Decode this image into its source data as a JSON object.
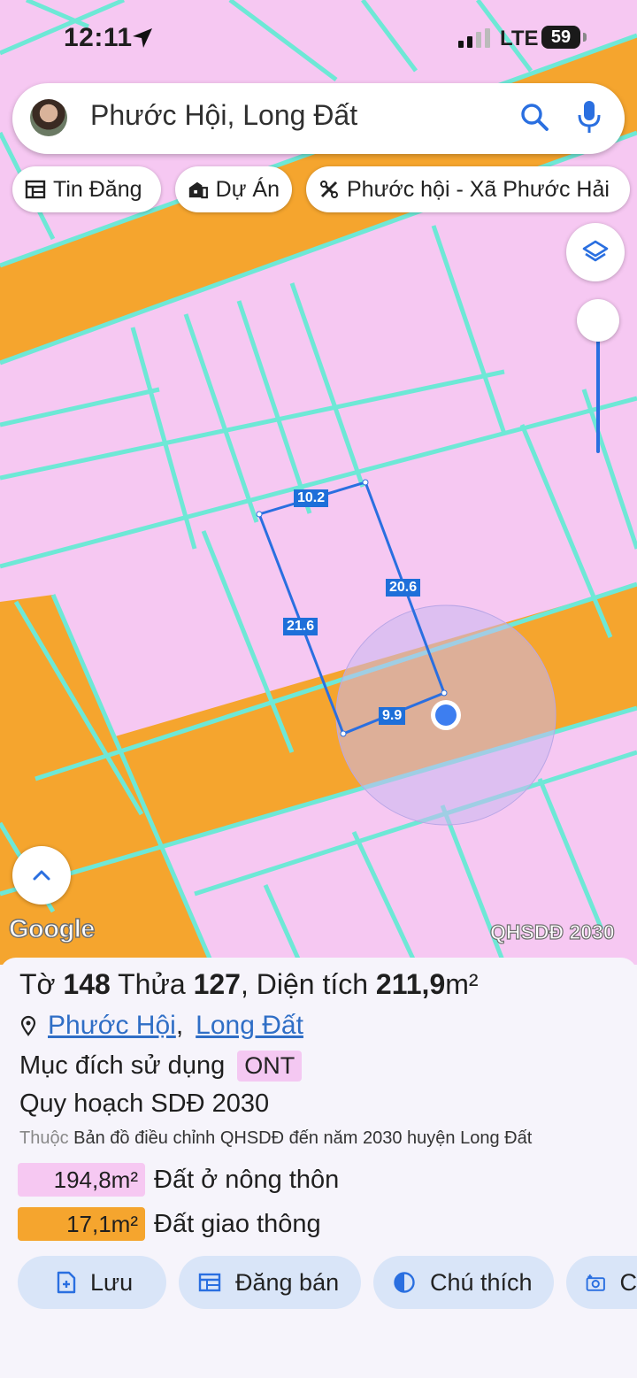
{
  "status": {
    "time": "12:11",
    "network": "LTE",
    "battery": "59"
  },
  "search": {
    "text": "Phước Hội, Long Đất"
  },
  "chips": [
    {
      "label": "Tin Đăng",
      "icon": "listing-icon"
    },
    {
      "label": "Dự Án",
      "icon": "building-icon"
    },
    {
      "label": "Phước hội - Xã Phước Hải",
      "icon": "tools-icon"
    }
  ],
  "map": {
    "measurements": {
      "top": "10.2",
      "right": "20.6",
      "left": "21.6",
      "bottom": "9.9"
    },
    "google_logo": "Google",
    "layer_name": "QHSDĐ 2030",
    "colors": {
      "residential": "#f6c8f2",
      "road": "#f5a52e",
      "border": "#6ee8d6",
      "outline": "#2a6fe0"
    }
  },
  "parcel": {
    "sheet_label": "Tờ",
    "sheet_no": "148",
    "plot_label": "Thửa",
    "plot_no": "127",
    "area_label": "Diện tích",
    "area_value": "211,9",
    "area_unit": "m²",
    "address_part1": "Phước Hội",
    "address_sep": ",",
    "address_part2": "Long Đất",
    "purpose_label": "Mục đích sử dụng",
    "purpose_code": "ONT",
    "plan_title": "Quy hoạch SDĐ 2030",
    "belongs_prefix": "Thuộc",
    "belongs_text": "Bản đồ điều chỉnh QHSDĐ đến năm 2030 huyện Long Đất",
    "zones": [
      {
        "area": "194,8m²",
        "label": "Đất ở nông thôn",
        "color": "#f6c8f2"
      },
      {
        "area": "17,1m²",
        "label": "Đất giao thông",
        "color": "#f5a52e"
      }
    ]
  },
  "actions": [
    {
      "label": "Lưu",
      "icon": "save-icon"
    },
    {
      "label": "Đăng bán",
      "icon": "post-icon"
    },
    {
      "label": "Chú thích",
      "icon": "legend-icon"
    },
    {
      "label": "C",
      "icon": "camera-icon"
    }
  ]
}
